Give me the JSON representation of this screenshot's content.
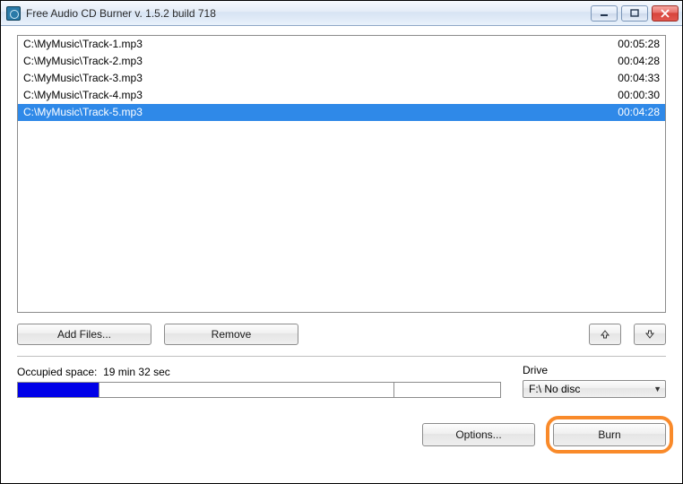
{
  "window": {
    "title": "Free Audio CD Burner  v. 1.5.2 build 718"
  },
  "tracks": [
    {
      "path": "C:\\MyMusic\\Track-1.mp3",
      "duration": "00:05:28",
      "selected": false
    },
    {
      "path": "C:\\MyMusic\\Track-2.mp3",
      "duration": "00:04:28",
      "selected": false
    },
    {
      "path": "C:\\MyMusic\\Track-3.mp3",
      "duration": "00:04:33",
      "selected": false
    },
    {
      "path": "C:\\MyMusic\\Track-4.mp3",
      "duration": "00:00:30",
      "selected": false
    },
    {
      "path": "C:\\MyMusic\\Track-5.mp3",
      "duration": "00:04:28",
      "selected": true
    }
  ],
  "buttons": {
    "add_files": "Add Files...",
    "remove": "Remove",
    "options": "Options...",
    "burn": "Burn"
  },
  "status": {
    "occupied_label": "Occupied space:",
    "occupied_value": "19 min 32 sec",
    "progress_percent": 17
  },
  "drive": {
    "label": "Drive",
    "selected": "F:\\ No disc"
  }
}
